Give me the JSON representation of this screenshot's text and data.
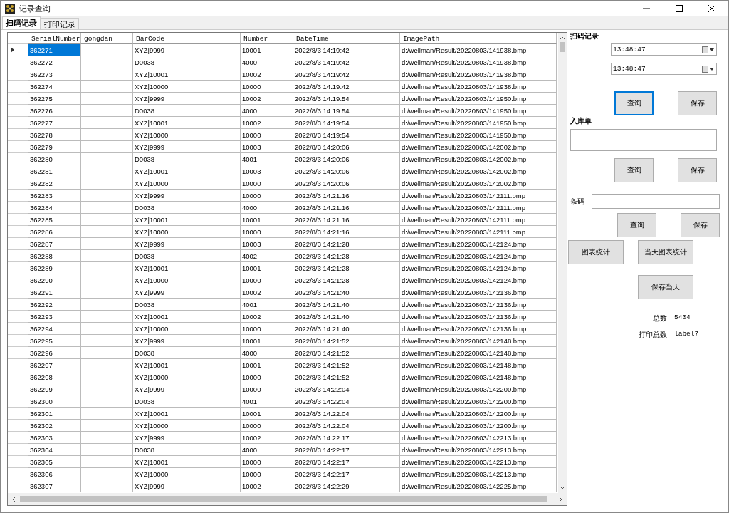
{
  "window": {
    "title": "记录查询"
  },
  "tabs": [
    {
      "label": "扫码记录",
      "selected": true
    },
    {
      "label": "打印记录",
      "selected": false
    }
  ],
  "grid": {
    "columns": [
      "SerialNumber",
      "gongdan",
      "BarCode",
      "Number",
      "DateTime",
      "ImagePath"
    ],
    "rows": [
      {
        "serial": "362271",
        "barcode": "XYZ|9999",
        "number": "10001",
        "datetime": "2022/8/3 14:19:42",
        "image_path": "d:/wellman/Result/20220803/141938.bmp",
        "selected": true
      },
      {
        "serial": "362272",
        "barcode": "D0038",
        "number": "4000",
        "datetime": "2022/8/3 14:19:42",
        "image_path": "d:/wellman/Result/20220803/141938.bmp",
        "selected": false
      },
      {
        "serial": "362273",
        "barcode": "XYZ|10001",
        "number": "10002",
        "datetime": "2022/8/3 14:19:42",
        "image_path": "d:/wellman/Result/20220803/141938.bmp",
        "selected": false
      },
      {
        "serial": "362274",
        "barcode": "XYZ|10000",
        "number": "10000",
        "datetime": "2022/8/3 14:19:42",
        "image_path": "d:/wellman/Result/20220803/141938.bmp",
        "selected": false
      },
      {
        "serial": "362275",
        "barcode": "XYZ|9999",
        "number": "10002",
        "datetime": "2022/8/3 14:19:54",
        "image_path": "d:/wellman/Result/20220803/141950.bmp",
        "selected": false
      },
      {
        "serial": "362276",
        "barcode": "D0038",
        "number": "4000",
        "datetime": "2022/8/3 14:19:54",
        "image_path": "d:/wellman/Result/20220803/141950.bmp",
        "selected": false
      },
      {
        "serial": "362277",
        "barcode": "XYZ|10001",
        "number": "10002",
        "datetime": "2022/8/3 14:19:54",
        "image_path": "d:/wellman/Result/20220803/141950.bmp",
        "selected": false
      },
      {
        "serial": "362278",
        "barcode": "XYZ|10000",
        "number": "10000",
        "datetime": "2022/8/3 14:19:54",
        "image_path": "d:/wellman/Result/20220803/141950.bmp",
        "selected": false
      },
      {
        "serial": "362279",
        "barcode": "XYZ|9999",
        "number": "10003",
        "datetime": "2022/8/3 14:20:06",
        "image_path": "d:/wellman/Result/20220803/142002.bmp",
        "selected": false
      },
      {
        "serial": "362280",
        "barcode": "D0038",
        "number": "4001",
        "datetime": "2022/8/3 14:20:06",
        "image_path": "d:/wellman/Result/20220803/142002.bmp",
        "selected": false
      },
      {
        "serial": "362281",
        "barcode": "XYZ|10001",
        "number": "10003",
        "datetime": "2022/8/3 14:20:06",
        "image_path": "d:/wellman/Result/20220803/142002.bmp",
        "selected": false
      },
      {
        "serial": "362282",
        "barcode": "XYZ|10000",
        "number": "10000",
        "datetime": "2022/8/3 14:20:06",
        "image_path": "d:/wellman/Result/20220803/142002.bmp",
        "selected": false
      },
      {
        "serial": "362283",
        "barcode": "XYZ|9999",
        "number": "10000",
        "datetime": "2022/8/3 14:21:16",
        "image_path": "d:/wellman/Result/20220803/142111.bmp",
        "selected": false
      },
      {
        "serial": "362284",
        "barcode": "D0038",
        "number": "4000",
        "datetime": "2022/8/3 14:21:16",
        "image_path": "d:/wellman/Result/20220803/142111.bmp",
        "selected": false
      },
      {
        "serial": "362285",
        "barcode": "XYZ|10001",
        "number": "10001",
        "datetime": "2022/8/3 14:21:16",
        "image_path": "d:/wellman/Result/20220803/142111.bmp",
        "selected": false
      },
      {
        "serial": "362286",
        "barcode": "XYZ|10000",
        "number": "10000",
        "datetime": "2022/8/3 14:21:16",
        "image_path": "d:/wellman/Result/20220803/142111.bmp",
        "selected": false
      },
      {
        "serial": "362287",
        "barcode": "XYZ|9999",
        "number": "10003",
        "datetime": "2022/8/3 14:21:28",
        "image_path": "d:/wellman/Result/20220803/142124.bmp",
        "selected": false
      },
      {
        "serial": "362288",
        "barcode": "D0038",
        "number": "4002",
        "datetime": "2022/8/3 14:21:28",
        "image_path": "d:/wellman/Result/20220803/142124.bmp",
        "selected": false
      },
      {
        "serial": "362289",
        "barcode": "XYZ|10001",
        "number": "10001",
        "datetime": "2022/8/3 14:21:28",
        "image_path": "d:/wellman/Result/20220803/142124.bmp",
        "selected": false
      },
      {
        "serial": "362290",
        "barcode": "XYZ|10000",
        "number": "10000",
        "datetime": "2022/8/3 14:21:28",
        "image_path": "d:/wellman/Result/20220803/142124.bmp",
        "selected": false
      },
      {
        "serial": "362291",
        "barcode": "XYZ|9999",
        "number": "10002",
        "datetime": "2022/8/3 14:21:40",
        "image_path": "d:/wellman/Result/20220803/142136.bmp",
        "selected": false
      },
      {
        "serial": "362292",
        "barcode": "D0038",
        "number": "4001",
        "datetime": "2022/8/3 14:21:40",
        "image_path": "d:/wellman/Result/20220803/142136.bmp",
        "selected": false
      },
      {
        "serial": "362293",
        "barcode": "XYZ|10001",
        "number": "10002",
        "datetime": "2022/8/3 14:21:40",
        "image_path": "d:/wellman/Result/20220803/142136.bmp",
        "selected": false
      },
      {
        "serial": "362294",
        "barcode": "XYZ|10000",
        "number": "10000",
        "datetime": "2022/8/3 14:21:40",
        "image_path": "d:/wellman/Result/20220803/142136.bmp",
        "selected": false
      },
      {
        "serial": "362295",
        "barcode": "XYZ|9999",
        "number": "10001",
        "datetime": "2022/8/3 14:21:52",
        "image_path": "d:/wellman/Result/20220803/142148.bmp",
        "selected": false
      },
      {
        "serial": "362296",
        "barcode": "D0038",
        "number": "4000",
        "datetime": "2022/8/3 14:21:52",
        "image_path": "d:/wellman/Result/20220803/142148.bmp",
        "selected": false
      },
      {
        "serial": "362297",
        "barcode": "XYZ|10001",
        "number": "10001",
        "datetime": "2022/8/3 14:21:52",
        "image_path": "d:/wellman/Result/20220803/142148.bmp",
        "selected": false
      },
      {
        "serial": "362298",
        "barcode": "XYZ|10000",
        "number": "10000",
        "datetime": "2022/8/3 14:21:52",
        "image_path": "d:/wellman/Result/20220803/142148.bmp",
        "selected": false
      },
      {
        "serial": "362299",
        "barcode": "XYZ|9999",
        "number": "10000",
        "datetime": "2022/8/3 14:22:04",
        "image_path": "d:/wellman/Result/20220803/142200.bmp",
        "selected": false
      },
      {
        "serial": "362300",
        "barcode": "D0038",
        "number": "4001",
        "datetime": "2022/8/3 14:22:04",
        "image_path": "d:/wellman/Result/20220803/142200.bmp",
        "selected": false
      },
      {
        "serial": "362301",
        "barcode": "XYZ|10001",
        "number": "10001",
        "datetime": "2022/8/3 14:22:04",
        "image_path": "d:/wellman/Result/20220803/142200.bmp",
        "selected": false
      },
      {
        "serial": "362302",
        "barcode": "XYZ|10000",
        "number": "10000",
        "datetime": "2022/8/3 14:22:04",
        "image_path": "d:/wellman/Result/20220803/142200.bmp",
        "selected": false
      },
      {
        "serial": "362303",
        "barcode": "XYZ|9999",
        "number": "10002",
        "datetime": "2022/8/3 14:22:17",
        "image_path": "d:/wellman/Result/20220803/142213.bmp",
        "selected": false
      },
      {
        "serial": "362304",
        "barcode": "D0038",
        "number": "4000",
        "datetime": "2022/8/3 14:22:17",
        "image_path": "d:/wellman/Result/20220803/142213.bmp",
        "selected": false
      },
      {
        "serial": "362305",
        "barcode": "XYZ|10001",
        "number": "10000",
        "datetime": "2022/8/3 14:22:17",
        "image_path": "d:/wellman/Result/20220803/142213.bmp",
        "selected": false
      },
      {
        "serial": "362306",
        "barcode": "XYZ|10000",
        "number": "10000",
        "datetime": "2022/8/3 14:22:17",
        "image_path": "d:/wellman/Result/20220803/142213.bmp",
        "selected": false
      },
      {
        "serial": "362307",
        "barcode": "XYZ|9999",
        "number": "10002",
        "datetime": "2022/8/3 14:22:29",
        "image_path": "d:/wellman/Result/20220803/142225.bmp",
        "selected": false
      }
    ]
  },
  "scan_panel": {
    "title": "扫码记录",
    "start_time": "13:48:47",
    "end_time": "13:48:47",
    "buttons": [
      {
        "label": "查询",
        "focused": true
      },
      {
        "label": "保存",
        "focused": false
      }
    ]
  },
  "inbound": {
    "label": "入库单",
    "buttons": [
      {
        "label": "查询",
        "focused": false
      },
      {
        "label": "保存",
        "focused": false
      }
    ]
  },
  "barcode": {
    "label": "条码",
    "buttons": [
      {
        "label": "查询",
        "focused": false
      },
      {
        "label": "保存",
        "focused": false
      }
    ]
  },
  "stats_buttons": [
    "图表统计",
    "当天图表统计",
    "保存当天"
  ],
  "totals": [
    {
      "label": "总数",
      "value": "5404"
    },
    {
      "label": "打印总数",
      "value": "label7"
    }
  ]
}
